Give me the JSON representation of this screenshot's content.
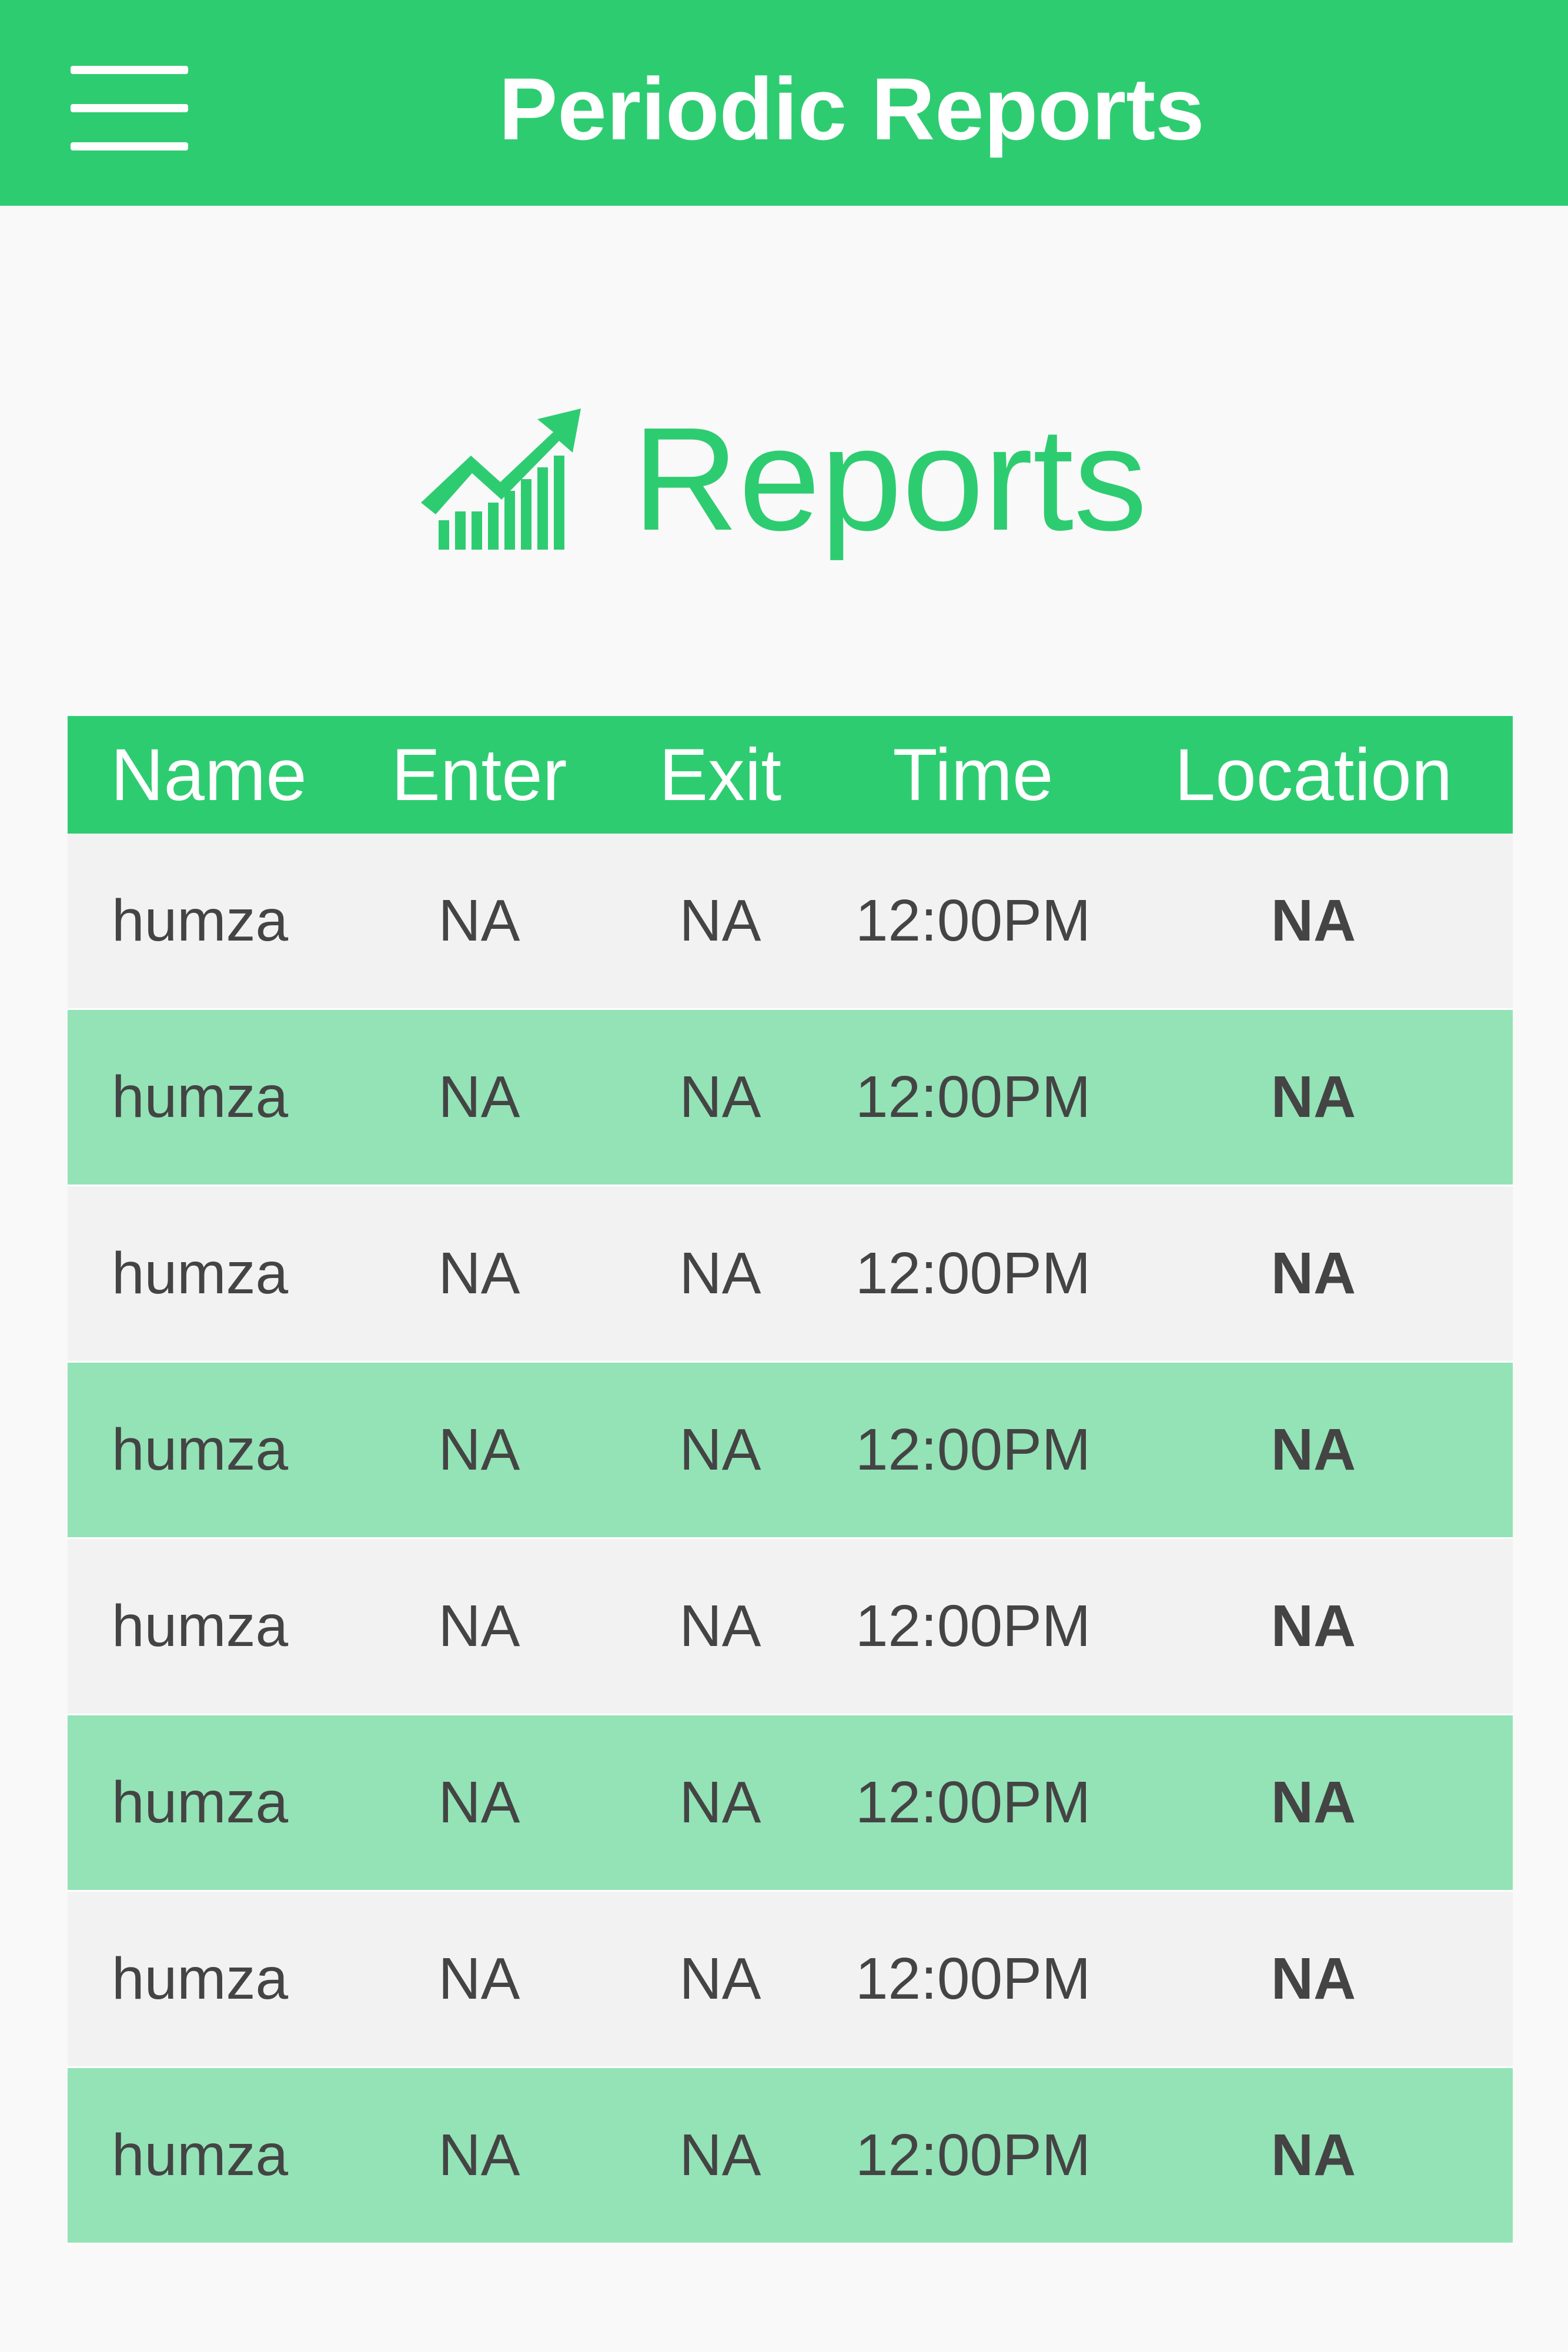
{
  "app_bar": {
    "title": "Periodic Reports",
    "menu_icon": "hamburger-menu-icon",
    "color": "#2ecc71"
  },
  "hero": {
    "icon": "trending-up-chart-icon",
    "title": "Reports"
  },
  "table": {
    "columns": [
      "Name",
      "Enter",
      "Exit",
      "Time",
      "Location"
    ],
    "rows": [
      {
        "name": "humza",
        "enter": "NA",
        "exit": "NA",
        "time": "12:00PM",
        "location": "NA"
      },
      {
        "name": "humza",
        "enter": "NA",
        "exit": "NA",
        "time": "12:00PM",
        "location": "NA"
      },
      {
        "name": "humza",
        "enter": "NA",
        "exit": "NA",
        "time": "12:00PM",
        "location": "NA"
      },
      {
        "name": "humza",
        "enter": "NA",
        "exit": "NA",
        "time": "12:00PM",
        "location": "NA"
      },
      {
        "name": "humza",
        "enter": "NA",
        "exit": "NA",
        "time": "12:00PM",
        "location": "NA"
      },
      {
        "name": "humza",
        "enter": "NA",
        "exit": "NA",
        "time": "12:00PM",
        "location": "NA"
      },
      {
        "name": "humza",
        "enter": "NA",
        "exit": "NA",
        "time": "12:00PM",
        "location": "NA"
      },
      {
        "name": "humza",
        "enter": "NA",
        "exit": "NA",
        "time": "12:00PM",
        "location": "NA"
      }
    ],
    "header_color": "#2ecc71",
    "odd_row_color": "#f2f2f2",
    "even_row_color": "#93e3b6"
  }
}
